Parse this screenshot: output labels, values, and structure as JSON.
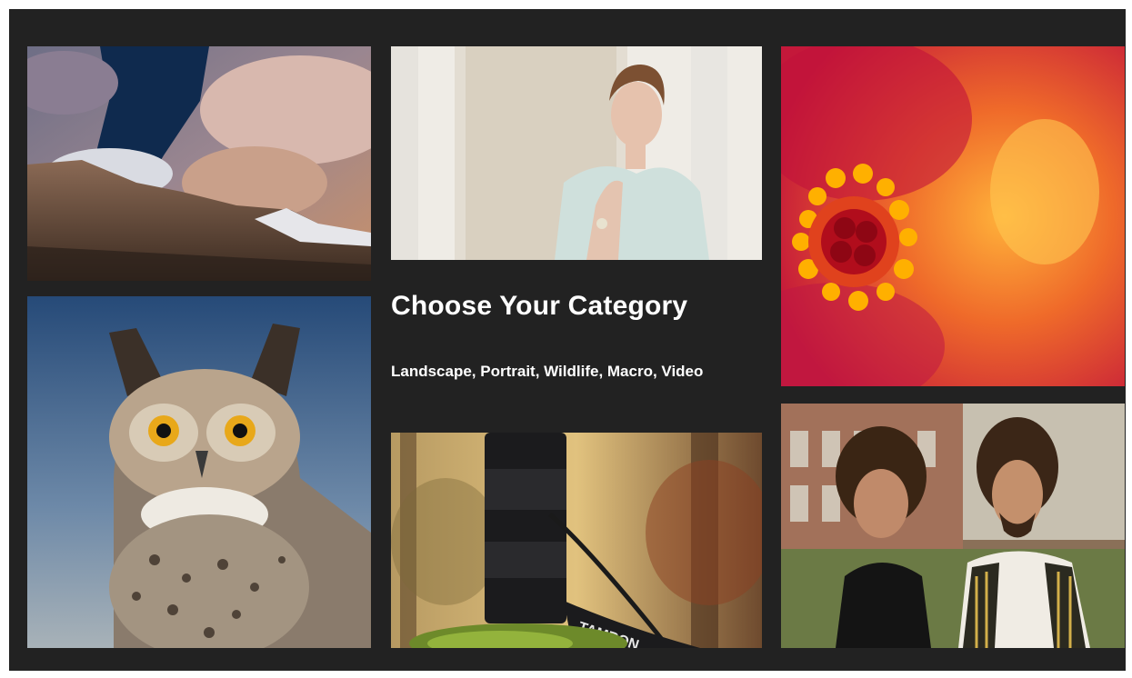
{
  "heading": "Choose Your Category",
  "categories_line": "Landscape, Portrait, Wildlife, Macro, Video",
  "lens_brand_text": "TAMRON",
  "colors": {
    "frame_background": "#222222",
    "text": "#ffffff"
  },
  "tiles": [
    {
      "name": "landscape-photo",
      "depicts": "mountain under cloudy sky"
    },
    {
      "name": "portrait-photo",
      "depicts": "woman in white lace dress"
    },
    {
      "name": "flower-macro-photo",
      "depicts": "red hibiscus close-up"
    },
    {
      "name": "owl-wildlife-photo",
      "depicts": "great horned owl"
    },
    {
      "name": "camera-lens-photo",
      "depicts": "lens on mossy stump"
    },
    {
      "name": "couple-portrait-photo",
      "depicts": "man and woman outdoors"
    }
  ]
}
